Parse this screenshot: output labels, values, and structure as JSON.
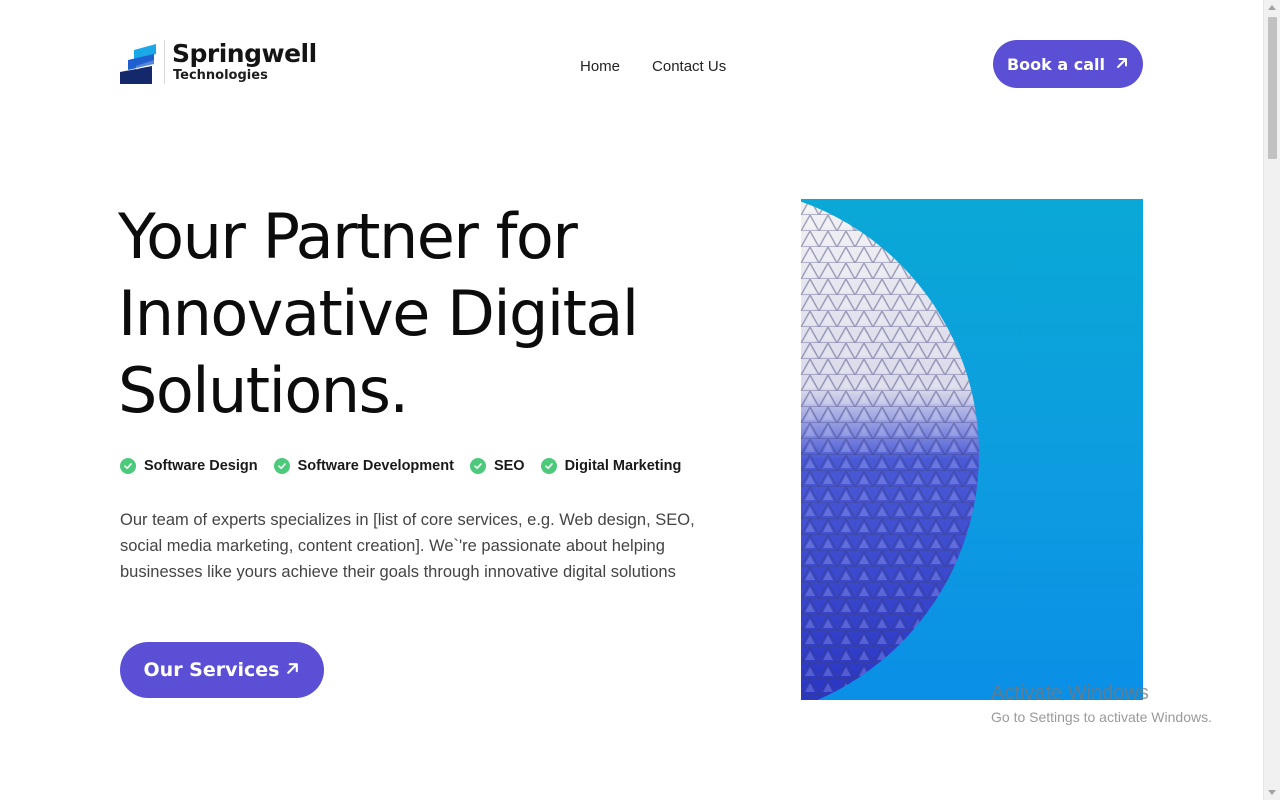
{
  "brand": {
    "name": "Springwell",
    "tagline": "Technologies",
    "colors": {
      "dark": "#14296b",
      "blue": "#1f5fd0",
      "cyan": "#1aa9e6"
    }
  },
  "nav": {
    "items": [
      {
        "label": "Home"
      },
      {
        "label": "Contact Us"
      }
    ]
  },
  "header": {
    "cta_label": "Book a call",
    "cta_icon": "arrow-up-right-icon"
  },
  "hero": {
    "title_lines": [
      "Your Partner for",
      "Innovative Digital",
      "Solutions."
    ],
    "features": [
      {
        "label": "Software Design",
        "icon": "check-circle-icon"
      },
      {
        "label": "Software Development",
        "icon": "check-circle-icon"
      },
      {
        "label": "SEO",
        "icon": "check-circle-icon"
      },
      {
        "label": "Digital Marketing",
        "icon": "check-circle-icon"
      }
    ],
    "description": "Our team of experts specializes in [list of core services, e.g. Web design, SEO, social media marketing, content creation]. We`'re passionate about helping businesses like yours achieve their goals through innovative digital solutions",
    "cta_label": "Our Services",
    "cta_icon": "arrow-up-right-icon"
  },
  "theme": {
    "accent": "#5a4fd5",
    "check_green": "#4cc97a"
  },
  "watermark": {
    "title": "Activate Windows",
    "subtitle": "Go to Settings to activate Windows."
  }
}
